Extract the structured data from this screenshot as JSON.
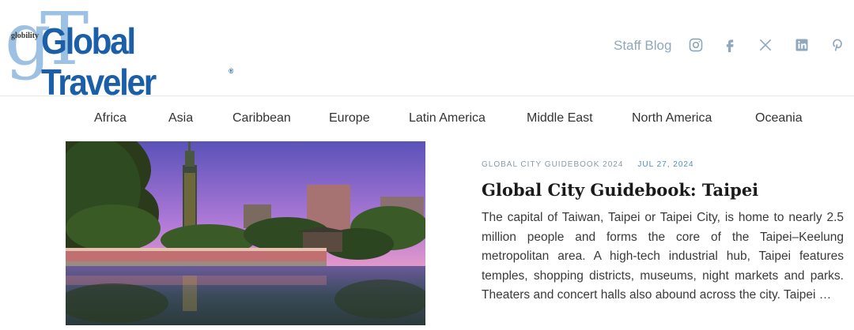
{
  "header": {
    "logo_small": "globility",
    "logo_big": "gT",
    "logo_text": "Global Traveler",
    "logo_reg": "®",
    "staff_blog": "Staff Blog",
    "social": [
      {
        "icon": "instagram-icon"
      },
      {
        "icon": "facebook-icon"
      },
      {
        "icon": "x-icon"
      },
      {
        "icon": "linkedin-icon"
      },
      {
        "icon": "pinterest-icon"
      }
    ]
  },
  "nav": {
    "items": [
      "Africa",
      "Asia",
      "Caribbean",
      "Europe",
      "Latin America",
      "Middle East",
      "North America",
      "Oceania"
    ]
  },
  "article": {
    "category": "GLOBAL CITY GUIDEBOOK 2024",
    "date": "JUL 27, 2024",
    "title": "Global City Guidebook: Taipei",
    "excerpt": "The capital of Taiwan, Taipei or Taipei City, is home to nearly 2.5 million people and forms the core of the Taipei–Keelung metropolitan area. A high-tech industrial hub, Taipei features temples, shopping districts, museums, night markets and parks. Theaters and concert halls also abound across the city. Taipei …"
  },
  "colors": {
    "brand_blue": "#1b5fa8",
    "logo_light_blue": "#9cc1e3",
    "social_gray": "#8fa8bd",
    "date_blue": "#4a90c8"
  }
}
